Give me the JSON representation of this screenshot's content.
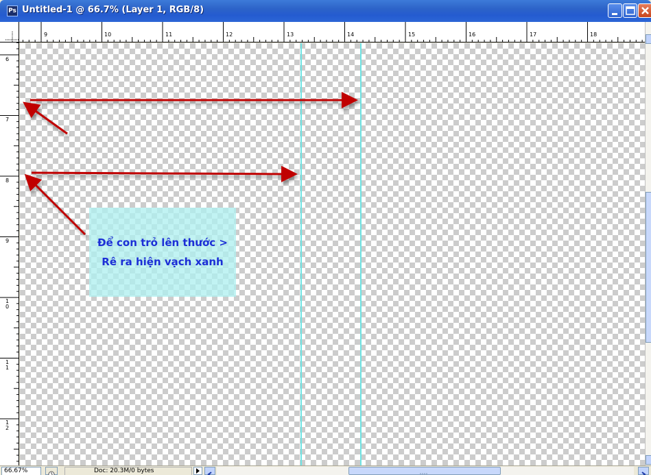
{
  "window": {
    "title": "Untitled-1 @ 66.7% (Layer 1, RGB/8)",
    "app_icon_label": "Ps"
  },
  "rulers": {
    "horizontal_labels": [
      "9",
      "10",
      "11",
      "12",
      "13",
      "14",
      "15",
      "16",
      "17",
      "18"
    ],
    "vertical_labels": [
      "6",
      "7",
      "8",
      "9",
      "10",
      "11",
      "12"
    ]
  },
  "canvas": {
    "note_text": "Để con trỏ lên thước > Rê ra hiện vạch xanh",
    "note_text_color": "#1c2fd6",
    "note_background": "#b0f0f0",
    "guide_color": "#6fe3e3",
    "arrow_color": "#c00000"
  },
  "statusbar": {
    "zoom": "66.67%",
    "doc_info": "Doc: 20.3M/0 bytes"
  },
  "icons": {
    "close": "close-icon",
    "minimize": "minimize-icon",
    "maximize": "maximize-icon"
  }
}
